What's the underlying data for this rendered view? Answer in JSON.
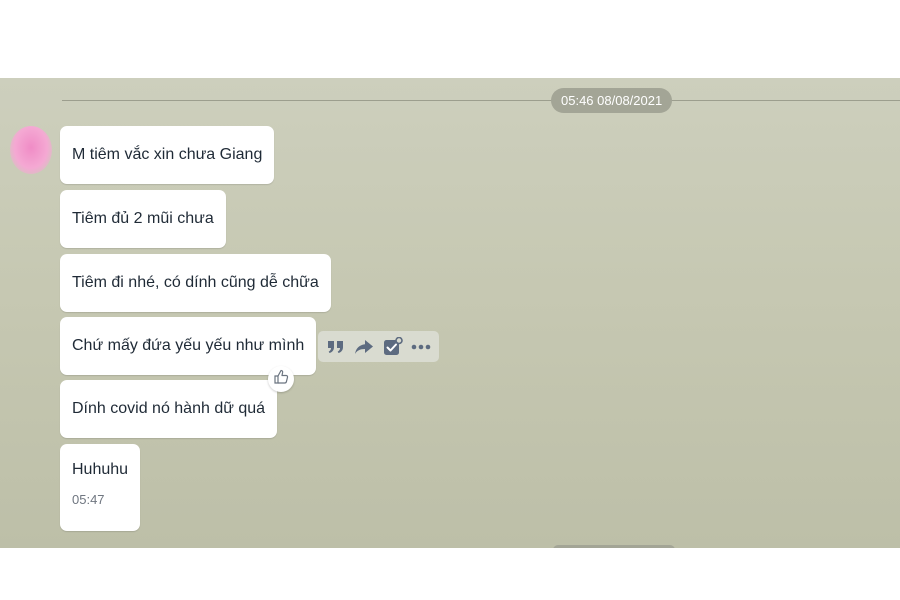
{
  "chat": {
    "date_separator": "05:46 08/08/2021",
    "messages": [
      {
        "text": "M tiêm vắc xin chưa Giang"
      },
      {
        "text": "Tiêm đủ 2 mũi chưa"
      },
      {
        "text": "Tiêm đi nhé, có dính cũng dễ chữa"
      },
      {
        "text": "Chứ mấy đứa yếu yếu như mình"
      },
      {
        "text": "Dính covid nó hành dữ quá"
      },
      {
        "text": "Huhuhu",
        "time": "05:47"
      }
    ]
  },
  "message_actions": [
    "quote-icon",
    "share-icon",
    "mark-task-icon",
    "more-icon"
  ],
  "reaction": "thumbs-up-icon",
  "colors": {
    "background": "#c6c8b2",
    "bubble": "#ffffff",
    "text": "#1f2a36",
    "icon": "#5d6b80",
    "time_pill": "#a3a596"
  }
}
